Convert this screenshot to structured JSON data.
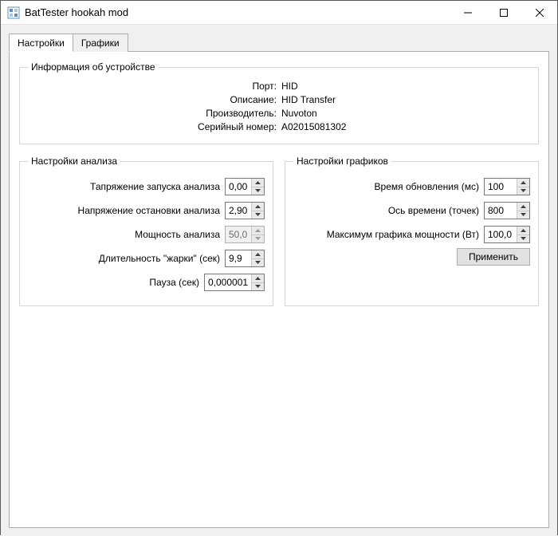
{
  "window": {
    "title": "BatTester hookah mod"
  },
  "tabs": {
    "settings": "Настройки",
    "graphs": "Графики"
  },
  "device_info": {
    "legend": "Информация об устройстве",
    "labels": {
      "port": "Порт:",
      "description": "Описание:",
      "manufacturer": "Производитель:",
      "serial": "Серийный номер:"
    },
    "values": {
      "port": "HID",
      "description": "HID Transfer",
      "manufacturer": "Nuvoton",
      "serial": "A02015081302"
    }
  },
  "analysis": {
    "legend": "Настройки анализа",
    "labels": {
      "start_voltage": "Тапряжение запуска анализа",
      "stop_voltage": "Напряжение остановки анализа",
      "power": "Мощность анализа",
      "fry_duration": "Длительность \"жарки\" (сек)",
      "pause": "Пауза (сек)"
    },
    "values": {
      "start_voltage": "0,00",
      "stop_voltage": "2,90",
      "power": "50,0",
      "fry_duration": "9,9",
      "pause": "0,000001"
    }
  },
  "graph": {
    "legend": "Настройки графиков",
    "labels": {
      "refresh_ms": "Время обновления (мс)",
      "time_axis_points": "Ось времени (точек)",
      "power_max": "Максимум графика мощности (Вт)"
    },
    "values": {
      "refresh_ms": "100",
      "time_axis_points": "800",
      "power_max": "100,0"
    },
    "apply": "Применить"
  }
}
